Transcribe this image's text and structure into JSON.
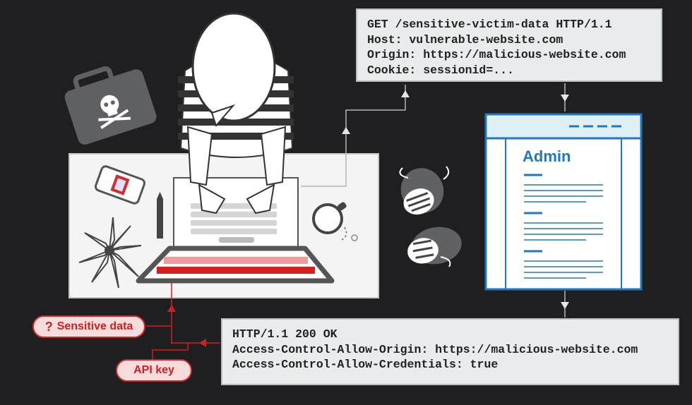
{
  "request": {
    "lines": [
      "GET /sensitive-victim-data HTTP/1.1",
      "Host: vulnerable-website.com",
      "Origin: https://malicious-website.com",
      "Cookie: sessionid=..."
    ]
  },
  "response": {
    "lines": [
      "HTTP/1.1 200 OK",
      "Access-Control-Allow-Origin: https://malicious-website.com",
      "Access-Control-Allow-Credentials: true"
    ]
  },
  "admin_page": {
    "title": "Admin"
  },
  "labels": {
    "sensitive_data": "Sensitive data",
    "api_key": "API key",
    "question_mark": "?"
  },
  "colors": {
    "background": "#1f1f21",
    "accent_red": "#cf2a2a",
    "admin_blue": "#1f78c0",
    "box_fill": "#e9ecec"
  }
}
